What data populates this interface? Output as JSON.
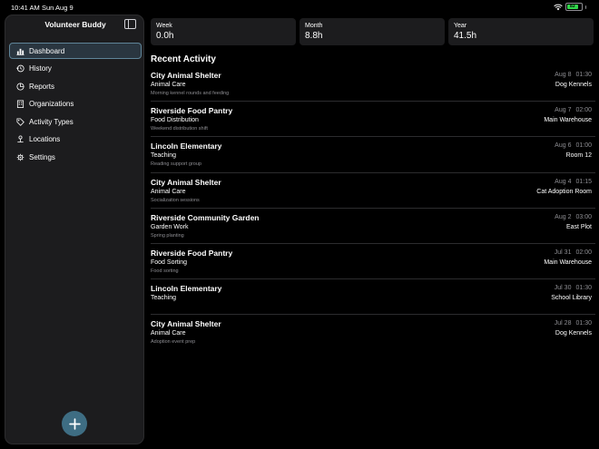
{
  "status_bar": {
    "time": "10:41 AM",
    "date": "Sun Aug 9",
    "battery": "83"
  },
  "sidebar": {
    "title": "Volunteer Buddy",
    "items": [
      {
        "label": "Dashboard",
        "icon": "chart-bar-icon",
        "active": true
      },
      {
        "label": "History",
        "icon": "clock-history-icon"
      },
      {
        "label": "Reports",
        "icon": "reports-icon"
      },
      {
        "label": "Organizations",
        "icon": "building-icon"
      },
      {
        "label": "Activity Types",
        "icon": "tag-icon"
      },
      {
        "label": "Locations",
        "icon": "location-pin-icon"
      },
      {
        "label": "Settings",
        "icon": "gear-icon"
      }
    ]
  },
  "stats": [
    {
      "label": "Week",
      "value": "0.0h"
    },
    {
      "label": "Month",
      "value": "8.8h"
    },
    {
      "label": "Year",
      "value": "41.5h"
    }
  ],
  "recent_activity": {
    "title": "Recent Activity",
    "items": [
      {
        "org": "City Animal Shelter",
        "type": "Animal Care",
        "note": "Morning kennel rounds and feeding",
        "date": "Aug 8",
        "duration": "01:30",
        "location": "Dog Kennels"
      },
      {
        "org": "Riverside Food Pantry",
        "type": "Food Distribution",
        "note": "Weekend distribution shift",
        "date": "Aug 7",
        "duration": "02:00",
        "location": "Main Warehouse"
      },
      {
        "org": "Lincoln Elementary",
        "type": "Teaching",
        "note": "Reading support group",
        "date": "Aug 6",
        "duration": "01:00",
        "location": "Room 12"
      },
      {
        "org": "City Animal Shelter",
        "type": "Animal Care",
        "note": "Socialization sessions",
        "date": "Aug 4",
        "duration": "01:15",
        "location": "Cat Adoption Room"
      },
      {
        "org": "Riverside Community Garden",
        "type": "Garden Work",
        "note": "Spring planting",
        "date": "Aug 2",
        "duration": "03:00",
        "location": "East Plot"
      },
      {
        "org": "Riverside Food Pantry",
        "type": "Food Sorting",
        "note": "Food sorting",
        "date": "Jul 31",
        "duration": "02:00",
        "location": "Main Warehouse"
      },
      {
        "org": "Lincoln Elementary",
        "type": "Teaching",
        "note": "",
        "date": "Jul 30",
        "duration": "01:30",
        "location": "School Library"
      },
      {
        "org": "City Animal Shelter",
        "type": "Animal Care",
        "note": "Adoption event prep",
        "date": "Jul 28",
        "duration": "01:30",
        "location": "Dog Kennels"
      }
    ]
  },
  "colors": {
    "background": "#000000",
    "surface": "#1c1c1e",
    "accent": "#3e6d83",
    "active_border": "#5f8599",
    "battery": "#32d74b",
    "secondary_text": "#8e8e93"
  }
}
